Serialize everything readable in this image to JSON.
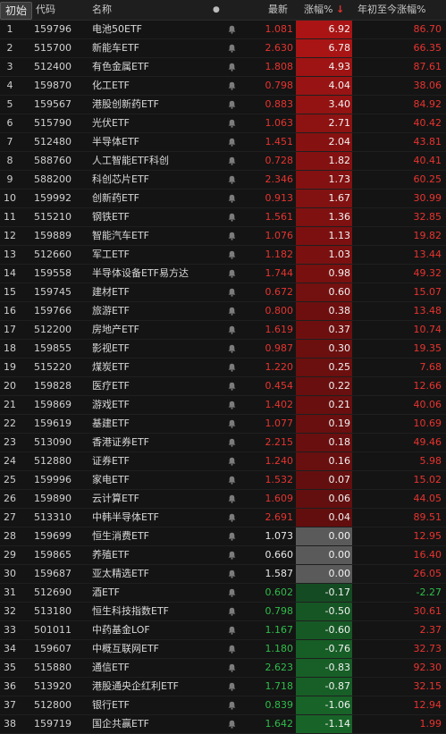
{
  "header": {
    "badge": "初始",
    "code": "代码",
    "name": "名称",
    "dot": "●",
    "price": "最新",
    "change": "涨幅%",
    "sort_arrow": "↓",
    "ytd": "年初至今涨幅%"
  },
  "colors": {
    "up": "#e8342f",
    "down": "#2fbd4a",
    "flat": "#e8e8e8"
  },
  "rows": [
    {
      "idx": "1",
      "code": "159796",
      "name": "电池50ETF",
      "price": "1.081",
      "change": "6.92",
      "ytd": "86.70"
    },
    {
      "idx": "2",
      "code": "515700",
      "name": "新能车ETF",
      "price": "2.630",
      "change": "6.78",
      "ytd": "66.35"
    },
    {
      "idx": "3",
      "code": "512400",
      "name": "有色金属ETF",
      "price": "1.808",
      "change": "4.93",
      "ytd": "87.61"
    },
    {
      "idx": "4",
      "code": "159870",
      "name": "化工ETF",
      "price": "0.798",
      "change": "4.04",
      "ytd": "38.06"
    },
    {
      "idx": "5",
      "code": "159567",
      "name": "港股创新药ETF",
      "price": "0.883",
      "change": "3.40",
      "ytd": "84.92"
    },
    {
      "idx": "6",
      "code": "515790",
      "name": "光伏ETF",
      "price": "1.063",
      "change": "2.71",
      "ytd": "40.42"
    },
    {
      "idx": "7",
      "code": "512480",
      "name": "半导体ETF",
      "price": "1.451",
      "change": "2.04",
      "ytd": "43.81"
    },
    {
      "idx": "8",
      "code": "588760",
      "name": "人工智能ETF科创",
      "price": "0.728",
      "change": "1.82",
      "ytd": "40.41"
    },
    {
      "idx": "9",
      "code": "588200",
      "name": "科创芯片ETF",
      "price": "2.346",
      "change": "1.73",
      "ytd": "60.25"
    },
    {
      "idx": "10",
      "code": "159992",
      "name": "创新药ETF",
      "price": "0.913",
      "change": "1.67",
      "ytd": "30.99"
    },
    {
      "idx": "11",
      "code": "515210",
      "name": "钢铁ETF",
      "price": "1.561",
      "change": "1.36",
      "ytd": "32.85"
    },
    {
      "idx": "12",
      "code": "159889",
      "name": "智能汽车ETF",
      "price": "1.076",
      "change": "1.13",
      "ytd": "19.82"
    },
    {
      "idx": "13",
      "code": "512660",
      "name": "军工ETF",
      "price": "1.182",
      "change": "1.03",
      "ytd": "13.44"
    },
    {
      "idx": "14",
      "code": "159558",
      "name": "半导体设备ETF易方达",
      "price": "1.744",
      "change": "0.98",
      "ytd": "49.32"
    },
    {
      "idx": "15",
      "code": "159745",
      "name": "建材ETF",
      "price": "0.672",
      "change": "0.60",
      "ytd": "15.07"
    },
    {
      "idx": "16",
      "code": "159766",
      "name": "旅游ETF",
      "price": "0.800",
      "change": "0.38",
      "ytd": "13.48"
    },
    {
      "idx": "17",
      "code": "512200",
      "name": "房地产ETF",
      "price": "1.619",
      "change": "0.37",
      "ytd": "10.74"
    },
    {
      "idx": "18",
      "code": "159855",
      "name": "影视ETF",
      "price": "0.987",
      "change": "0.30",
      "ytd": "19.35"
    },
    {
      "idx": "19",
      "code": "515220",
      "name": "煤炭ETF",
      "price": "1.220",
      "change": "0.25",
      "ytd": "7.68"
    },
    {
      "idx": "20",
      "code": "159828",
      "name": "医疗ETF",
      "price": "0.454",
      "change": "0.22",
      "ytd": "12.66"
    },
    {
      "idx": "21",
      "code": "159869",
      "name": "游戏ETF",
      "price": "1.402",
      "change": "0.21",
      "ytd": "40.06"
    },
    {
      "idx": "22",
      "code": "159619",
      "name": "基建ETF",
      "price": "1.077",
      "change": "0.19",
      "ytd": "10.69"
    },
    {
      "idx": "23",
      "code": "513090",
      "name": "香港证券ETF",
      "price": "2.215",
      "change": "0.18",
      "ytd": "49.46"
    },
    {
      "idx": "24",
      "code": "512880",
      "name": "证券ETF",
      "price": "1.240",
      "change": "0.16",
      "ytd": "5.98"
    },
    {
      "idx": "25",
      "code": "159996",
      "name": "家电ETF",
      "price": "1.532",
      "change": "0.07",
      "ytd": "15.02"
    },
    {
      "idx": "26",
      "code": "159890",
      "name": "云计算ETF",
      "price": "1.609",
      "change": "0.06",
      "ytd": "44.05"
    },
    {
      "idx": "27",
      "code": "513310",
      "name": "中韩半导体ETF",
      "price": "2.691",
      "change": "0.04",
      "ytd": "89.51"
    },
    {
      "idx": "28",
      "code": "159699",
      "name": "恒生消费ETF",
      "price": "1.073",
      "change": "0.00",
      "ytd": "12.95"
    },
    {
      "idx": "29",
      "code": "159865",
      "name": "养殖ETF",
      "price": "0.660",
      "change": "0.00",
      "ytd": "16.40"
    },
    {
      "idx": "30",
      "code": "159687",
      "name": "亚太精选ETF",
      "price": "1.587",
      "change": "0.00",
      "ytd": "26.05"
    },
    {
      "idx": "31",
      "code": "512690",
      "name": "酒ETF",
      "price": "0.602",
      "change": "-0.17",
      "ytd": "-2.27"
    },
    {
      "idx": "32",
      "code": "513180",
      "name": "恒生科技指数ETF",
      "price": "0.798",
      "change": "-0.50",
      "ytd": "30.61"
    },
    {
      "idx": "33",
      "code": "501011",
      "name": "中药基金LOF",
      "price": "1.167",
      "change": "-0.60",
      "ytd": "2.37"
    },
    {
      "idx": "34",
      "code": "159607",
      "name": "中概互联网ETF",
      "price": "1.180",
      "change": "-0.76",
      "ytd": "32.73"
    },
    {
      "idx": "35",
      "code": "515880",
      "name": "通信ETF",
      "price": "2.623",
      "change": "-0.83",
      "ytd": "92.30"
    },
    {
      "idx": "36",
      "code": "513920",
      "name": "港股通央企红利ETF",
      "price": "1.718",
      "change": "-0.87",
      "ytd": "32.15"
    },
    {
      "idx": "37",
      "code": "512800",
      "name": "银行ETF",
      "price": "0.839",
      "change": "-1.06",
      "ytd": "12.94"
    },
    {
      "idx": "38",
      "code": "159719",
      "name": "国企共赢ETF",
      "price": "1.642",
      "change": "-1.14",
      "ytd": "1.99"
    }
  ]
}
